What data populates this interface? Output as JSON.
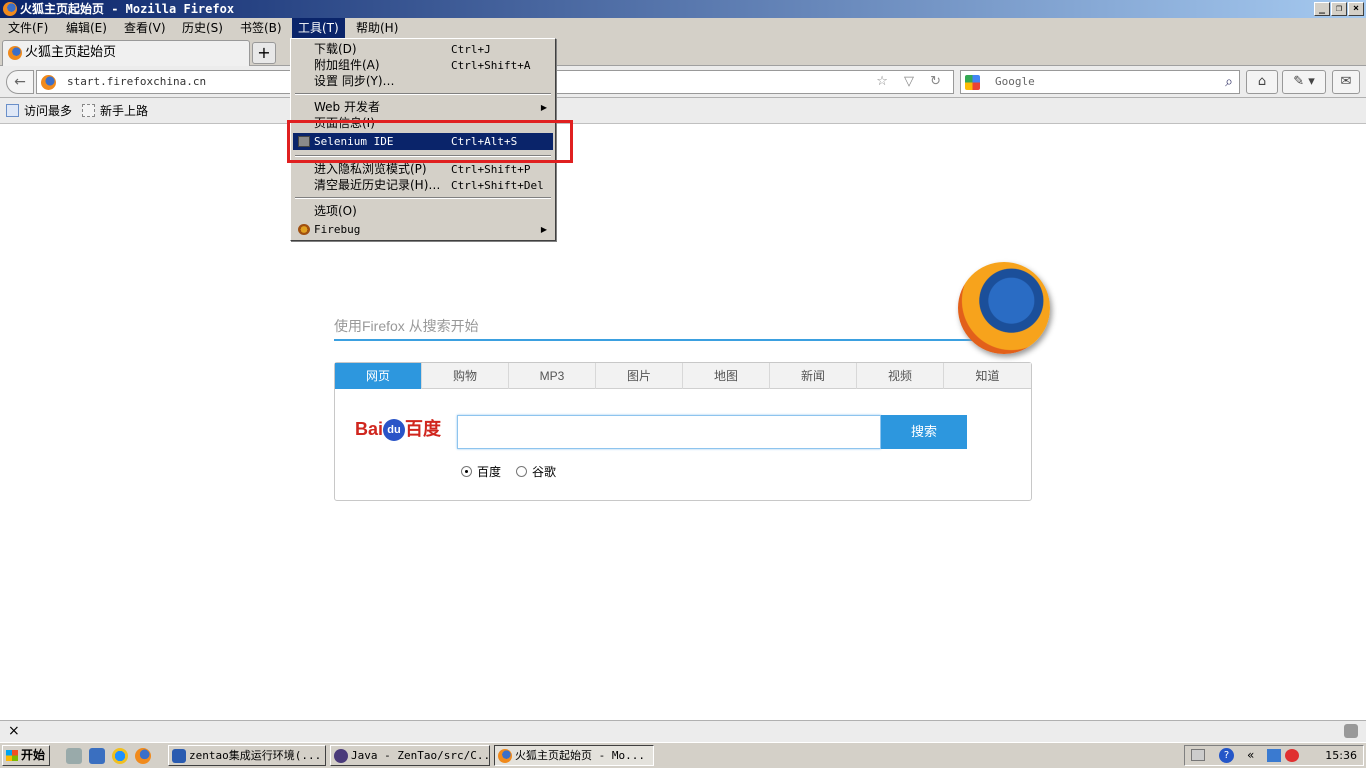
{
  "window": {
    "title": "火狐主页起始页 - Mozilla Firefox"
  },
  "menubar": {
    "items": [
      "文件(F)",
      "编辑(E)",
      "查看(V)",
      "历史(S)",
      "书签(B)",
      "工具(T)",
      "帮助(H)"
    ],
    "active": "工具(T)"
  },
  "tab": {
    "label": "火狐主页起始页",
    "new_tab": "+"
  },
  "navbar": {
    "url": "start.firefoxchina.cn",
    "search_placeholder": "Google",
    "url_icons": "☆ ▽ ↻",
    "home": "⌂",
    "back": "←"
  },
  "bookmarks": {
    "items": [
      "访问最多",
      "新手上路"
    ]
  },
  "tools_menu": {
    "items": [
      {
        "label": "下载(D)",
        "shortcut": "Ctrl+J"
      },
      {
        "label": "附加组件(A)",
        "shortcut": "Ctrl+Shift+A"
      },
      {
        "label": "设置 同步(Y)…",
        "shortcut": ""
      },
      {
        "label": "Web 开发者",
        "shortcut": "",
        "submenu": true
      },
      {
        "label": "页面信息(I)",
        "shortcut": ""
      },
      {
        "label": "Selenium IDE",
        "shortcut": "Ctrl+Alt+S",
        "highlighted": true
      },
      {
        "label": "进入隐私浏览模式(P)",
        "shortcut": "Ctrl+Shift+P"
      },
      {
        "label": "清空最近历史记录(H)…",
        "shortcut": "Ctrl+Shift+Del"
      },
      {
        "label": "选项(O)",
        "shortcut": ""
      },
      {
        "label": "Firebug",
        "shortcut": "",
        "submenu": true
      }
    ],
    "submenu_arrow": "▶"
  },
  "page": {
    "slogan": "使用Firefox  从搜索开始",
    "tabs": [
      "网页",
      "购物",
      "MP3",
      "图片",
      "地图",
      "新闻",
      "视频",
      "知道"
    ],
    "active_tab": "网页",
    "logo_left": "Bai",
    "logo_du": "du",
    "logo_right": "百度",
    "search_button": "搜索",
    "engines": [
      "百度",
      "谷歌"
    ],
    "selected_engine": "百度"
  },
  "statusbar": {
    "close": "×"
  },
  "taskbar": {
    "start": "开始",
    "windows": [
      "zentao集成运行环境(...",
      "Java - ZenTao/src/C...",
      "火狐主页起始页 - Mo..."
    ],
    "clock": "15:36"
  },
  "colors": {
    "highlight": "#0a246a",
    "accent_blue": "#2d97de",
    "annotation_red": "#e02020"
  }
}
